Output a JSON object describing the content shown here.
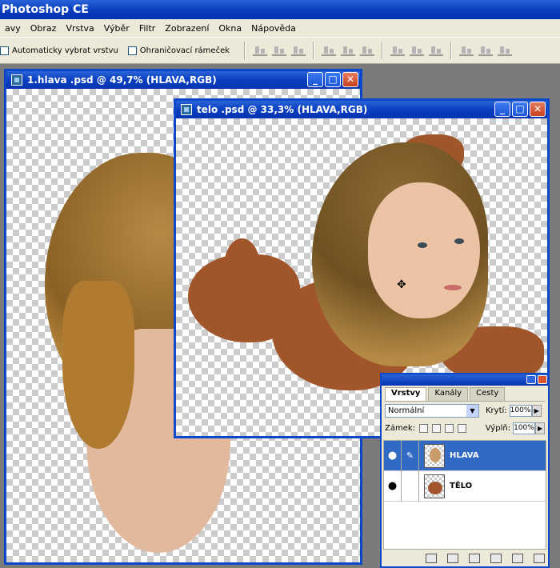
{
  "app": {
    "title": "Photoshop CE"
  },
  "menu": [
    "avy",
    "Obraz",
    "Vrstva",
    "Výběr",
    "Filtr",
    "Zobrazení",
    "Okna",
    "Nápověda"
  ],
  "options": {
    "auto_select": "Automaticky vybrat vrstvu",
    "bounding_box": "Ohraničovací rámeček"
  },
  "doc1": {
    "title": "1.hlava .psd @ 49,7% (HLAVA,RGB)"
  },
  "doc2": {
    "title": "telo .psd @ 33,3% (HLAVA,RGB)"
  },
  "window_buttons": {
    "minimize": "_",
    "maximize": "□",
    "close": "✕"
  },
  "layers_panel": {
    "tabs": [
      "Vrstvy",
      "Kanály",
      "Cesty"
    ],
    "blend_mode": "Normální",
    "opacity_label": "Krytí:",
    "opacity_value": "100%",
    "lock_label": "Zámek:",
    "fill_label": "Výplň:",
    "fill_value": "100%",
    "layers": [
      {
        "name": "HLAVA",
        "selected": true
      },
      {
        "name": "TĚLO",
        "selected": false
      }
    ]
  },
  "colors": {
    "xp_blue": "#0b48c9",
    "selection": "#316ac5",
    "clay": "#a0552a"
  }
}
